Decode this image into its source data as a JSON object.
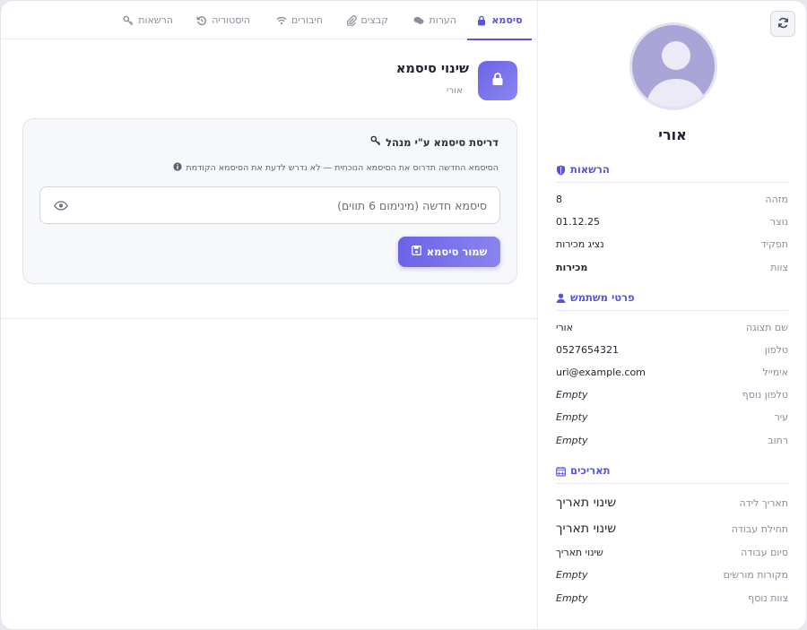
{
  "colors": {
    "accent": "#5b54d6",
    "avatar_bg": "#a9a5d6"
  },
  "tabs": [
    {
      "label": "סיסמא",
      "icon": "lock-icon",
      "active": true
    },
    {
      "label": "הערות",
      "icon": "comments-icon",
      "active": false
    },
    {
      "label": "קבצים",
      "icon": "paperclip-icon",
      "active": false
    },
    {
      "label": "חיבורים",
      "icon": "wifi-icon",
      "active": false
    },
    {
      "label": "היסטוריה",
      "icon": "history-icon",
      "active": false
    },
    {
      "label": "הרשאות",
      "icon": "key-icon",
      "active": false
    }
  ],
  "header": {
    "title": "שינוי סיסמא",
    "subtitle": "אורי"
  },
  "card": {
    "title": "דריסת סיסמא ע\"י מנהל",
    "note": "הסיסמא החדשה תדרוס את הסיסמא הנוכחית — לא נדרש לדעת את הסיסמא הקודמת",
    "input_placeholder": "סיסמא חדשה (מינימום 6 תווים)",
    "input_value": "",
    "save_label": "שמור סיסמא"
  },
  "sidebar": {
    "name": "אורי",
    "permissions": {
      "title": "הרשאות",
      "rows": [
        {
          "label": "מזהה",
          "value": "8"
        },
        {
          "label": "נוצר",
          "value": "01.12.25"
        },
        {
          "label": "תפקיד",
          "value": "נציג מכירות"
        },
        {
          "label": "צוות",
          "value": "מכירות"
        }
      ]
    },
    "user_details": {
      "title": "פרטי משתמש",
      "rows": [
        {
          "label": "שם תצוגה",
          "value": "אורי"
        },
        {
          "label": "טלפון",
          "value": "0527654321"
        },
        {
          "label": "אימייל",
          "value": "uri@example.com"
        },
        {
          "label": "טלפון נוסף",
          "value": "Empty"
        },
        {
          "label": "עיר",
          "value": "Empty"
        },
        {
          "label": "רחוב",
          "value": "Empty"
        }
      ]
    },
    "dates": {
      "title": "תאריכים",
      "rows": [
        {
          "label": "תאריך לידה",
          "value": "שינוי תאריך"
        },
        {
          "label": "תחילת עבודה",
          "value": "שינוי תאריך"
        },
        {
          "label": "סיום עבודה",
          "value": "שינוי תאריך"
        },
        {
          "label": "מקורות מורשים",
          "value": "Empty"
        },
        {
          "label": "צוות נוסף",
          "value": "Empty"
        }
      ]
    }
  }
}
